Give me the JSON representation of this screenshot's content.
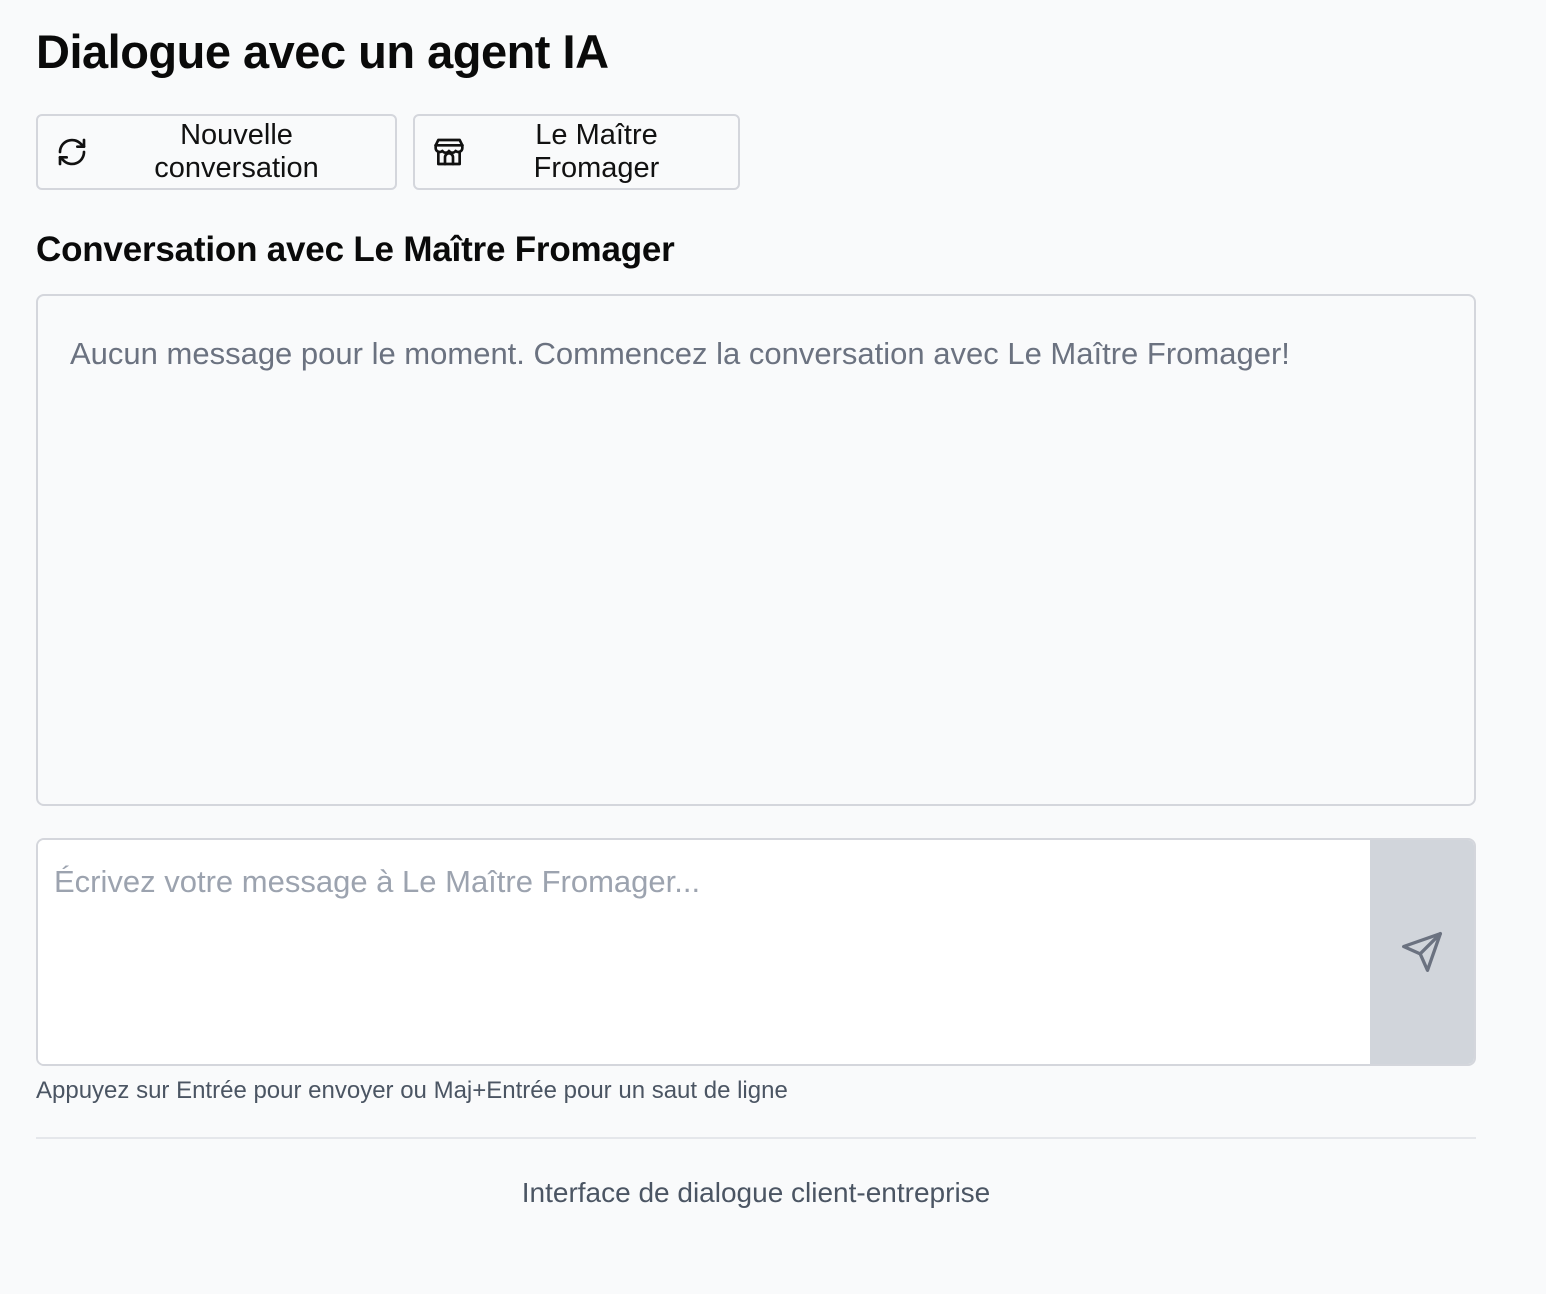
{
  "header": {
    "title": "Dialogue avec un agent IA"
  },
  "toolbar": {
    "new_conversation": {
      "label": "Nouvelle conversation",
      "icon": "refresh-icon"
    },
    "business": {
      "label": "Le Maître Fromager",
      "icon": "store-icon"
    }
  },
  "conversation": {
    "heading": "Conversation avec Le Maître Fromager",
    "empty_message": "Aucun message pour le moment. Commencez la conversation avec Le Maître Fromager!"
  },
  "composer": {
    "value": "",
    "placeholder": "Écrivez votre message à Le Maître Fromager...",
    "send_icon": "send-icon",
    "hint": "Appuyez sur Entrée pour envoyer ou Maj+Entrée pour un saut de ligne"
  },
  "footer": {
    "text": "Interface de dialogue client-entreprise"
  },
  "colors": {
    "background": "#f9fafb",
    "border": "#d4d6dc",
    "muted_text": "#6b7280",
    "send_button_bg": "#d1d5db"
  }
}
